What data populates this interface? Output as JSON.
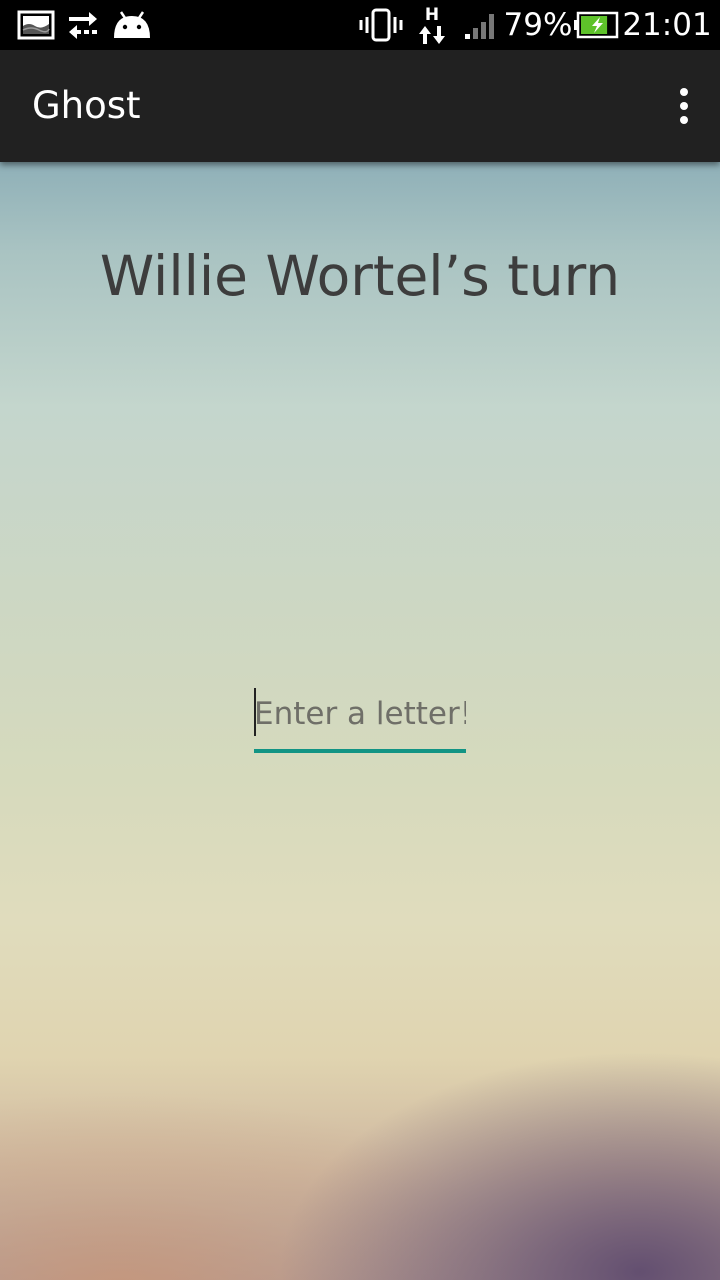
{
  "status_bar": {
    "icons_left": [
      "gallery-icon",
      "sync-arrows-icon",
      "android-icon"
    ],
    "icons_right": [
      "vibrate-icon",
      "hspa-data-icon",
      "signal-icon",
      "battery-charging-icon"
    ],
    "network_type": "H",
    "battery_percent": "79%",
    "battery_level": 0.79,
    "time": "21:01"
  },
  "action_bar": {
    "title": "Ghost",
    "menu_icon": "overflow-menu-icon"
  },
  "main": {
    "turn_heading": "Willie Wortel’s turn",
    "letter_input": {
      "value": "",
      "placeholder": "Enter a letter!"
    }
  },
  "colors": {
    "action_bar_bg": "#212121",
    "status_bar_bg": "#000000",
    "accent": "#129484",
    "text": "#3d3d3d",
    "battery_fill": "#5ec22a"
  }
}
